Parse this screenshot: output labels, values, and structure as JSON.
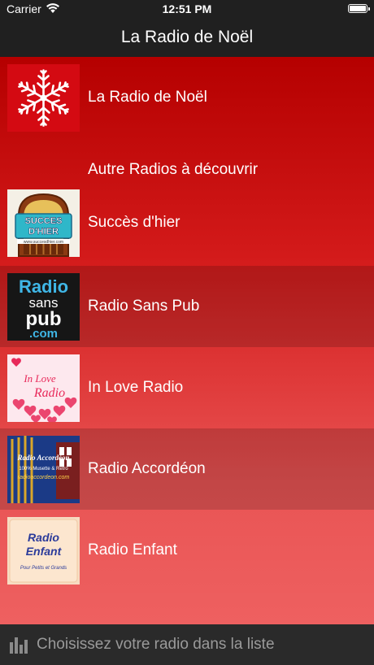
{
  "status": {
    "carrier": "Carrier",
    "time": "12:51 PM"
  },
  "nav": {
    "title": "La Radio de Noël"
  },
  "main_station": {
    "name": "La Radio de Noël"
  },
  "section": {
    "title": "Autre Radios à découvrir"
  },
  "stations": [
    {
      "name": "Succès d'hier",
      "logo_lines": [
        "SUCCES",
        "D'HIER"
      ],
      "logo_url": "www.succesdhier.com"
    },
    {
      "name": "Radio Sans Pub",
      "logo_lines": [
        "Radio",
        "sans",
        "pub",
        ".com"
      ]
    },
    {
      "name": "In Love Radio",
      "logo_lines": [
        "In Love",
        "Radio"
      ]
    },
    {
      "name": "Radio Accordéon",
      "logo_lines": [
        "Radio Accordéon",
        "100% Musette & Retro",
        "radioaccordeon.com"
      ]
    },
    {
      "name": "Radio Enfant",
      "logo_lines": [
        "Radio",
        "Enfant",
        "Pour Petits et Grands"
      ]
    }
  ],
  "footer": {
    "text": "Choisissez votre radio dans la liste"
  }
}
